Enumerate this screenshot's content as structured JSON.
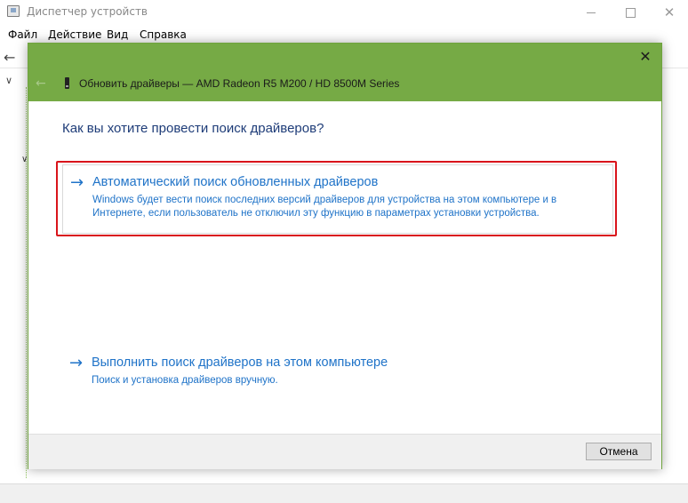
{
  "device_manager": {
    "title": "Диспетчер устройств",
    "menu": [
      "Файл",
      "Действие",
      "Вид",
      "Справка"
    ]
  },
  "window_controls": {
    "close_glyph": "✕"
  },
  "dialog": {
    "title": "Обновить драйверы — AMD Radeon R5 M200 / HD 8500M Series",
    "close_glyph": "✕",
    "question": "Как вы хотите провести поиск драйверов?",
    "options": [
      {
        "title": "Автоматический поиск обновленных драйверов",
        "description_line1": "Windows будет вести поиск последних версий драйверов для устройства на этом компьютере и в",
        "description_line2": "Интернете, если пользователь не отключил эту функцию в параметрах установки устройства.",
        "highlighted": true
      },
      {
        "title": "Выполнить поиск драйверов на этом компьютере",
        "description_line1": "Поиск и установка драйверов вручную.",
        "highlighted": false
      }
    ],
    "cancel_label": "Отмена"
  },
  "colors": {
    "dialog_header": "#76aa45",
    "link_blue": "#1f73c8",
    "highlight_red": "#d9141b"
  },
  "icons": {
    "option_arrow": "→",
    "back_arrow": "←"
  }
}
